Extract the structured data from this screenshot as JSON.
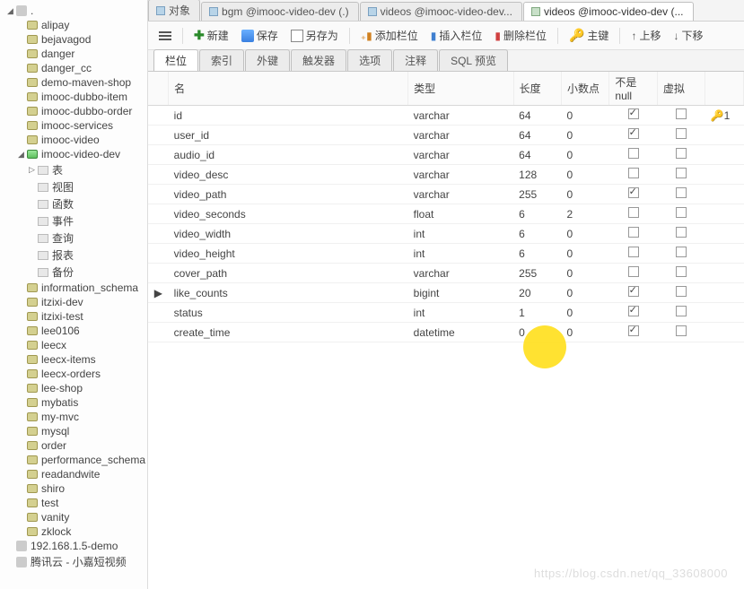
{
  "sidebar": {
    "root_expanded_label": ".",
    "databases_l1": [
      "alipay",
      "bejavagod",
      "danger",
      "danger_cc",
      "demo-maven-shop",
      "imooc-dubbo-item",
      "imooc-dubbo-order",
      "imooc-services",
      "imooc-video"
    ],
    "active_db": "imooc-video-dev",
    "db_children": [
      {
        "label": "表",
        "icon": "table"
      },
      {
        "label": "视图",
        "icon": "view"
      },
      {
        "label": "函数",
        "icon": "fn"
      },
      {
        "label": "事件",
        "icon": "event"
      },
      {
        "label": "查询",
        "icon": "query"
      },
      {
        "label": "报表",
        "icon": "report"
      },
      {
        "label": "备份",
        "icon": "backup"
      }
    ],
    "databases_l1_after": [
      "information_schema",
      "itzixi-dev",
      "itzixi-test",
      "lee0106",
      "leecx",
      "leecx-items",
      "leecx-orders",
      "lee-shop",
      "mybatis",
      "my-mvc",
      "mysql",
      "order",
      "performance_schema",
      "readandwite",
      "shiro",
      "test",
      "vanity",
      "zklock"
    ],
    "other_connections": [
      "192.168.1.5-demo",
      "腾讯云 - 小嘉短视频"
    ]
  },
  "top_tabs": [
    {
      "label": "对象",
      "active": false
    },
    {
      "label": "bgm @imooc-video-dev (.)",
      "active": false
    },
    {
      "label": "videos @imooc-video-dev...",
      "active": false
    },
    {
      "label": "videos @imooc-video-dev (...",
      "active": true
    }
  ],
  "toolbar": {
    "new": "新建",
    "save": "保存",
    "saveas": "另存为",
    "addcol": "添加栏位",
    "inscol": "插入栏位",
    "delcol": "删除栏位",
    "pkey": "主键",
    "up": "上移",
    "down": "下移"
  },
  "subtabs": [
    "栏位",
    "索引",
    "外键",
    "触发器",
    "选项",
    "注释",
    "SQL 预览"
  ],
  "grid": {
    "headers": {
      "name": "名",
      "type": "类型",
      "length": "长度",
      "decimals": "小数点",
      "notnull": "不是 null",
      "virtual": "虚拟",
      "keylabel": ""
    },
    "rows": [
      {
        "name": "id",
        "type": "varchar",
        "len": "64",
        "dec": "0",
        "nn": true,
        "virt": false,
        "key": "1"
      },
      {
        "name": "user_id",
        "type": "varchar",
        "len": "64",
        "dec": "0",
        "nn": true,
        "virt": false
      },
      {
        "name": "audio_id",
        "type": "varchar",
        "len": "64",
        "dec": "0",
        "nn": false,
        "virt": false
      },
      {
        "name": "video_desc",
        "type": "varchar",
        "len": "128",
        "dec": "0",
        "nn": false,
        "virt": false
      },
      {
        "name": "video_path",
        "type": "varchar",
        "len": "255",
        "dec": "0",
        "nn": true,
        "virt": false
      },
      {
        "name": "video_seconds",
        "type": "float",
        "len": "6",
        "dec": "2",
        "nn": false,
        "virt": false
      },
      {
        "name": "video_width",
        "type": "int",
        "len": "6",
        "dec": "0",
        "nn": false,
        "virt": false
      },
      {
        "name": "video_height",
        "type": "int",
        "len": "6",
        "dec": "0",
        "nn": false,
        "virt": false
      },
      {
        "name": "cover_path",
        "type": "varchar",
        "len": "255",
        "dec": "0",
        "nn": false,
        "virt": false
      },
      {
        "name": "like_counts",
        "type": "bigint",
        "len": "20",
        "dec": "0",
        "nn": true,
        "virt": false,
        "current": true
      },
      {
        "name": "status",
        "type": "int",
        "len": "1",
        "dec": "0",
        "nn": true,
        "virt": false
      },
      {
        "name": "create_time",
        "type": "datetime",
        "len": "0",
        "dec": "0",
        "nn": true,
        "virt": false
      }
    ]
  },
  "watermark": "https://blog.csdn.net/qq_33608000"
}
